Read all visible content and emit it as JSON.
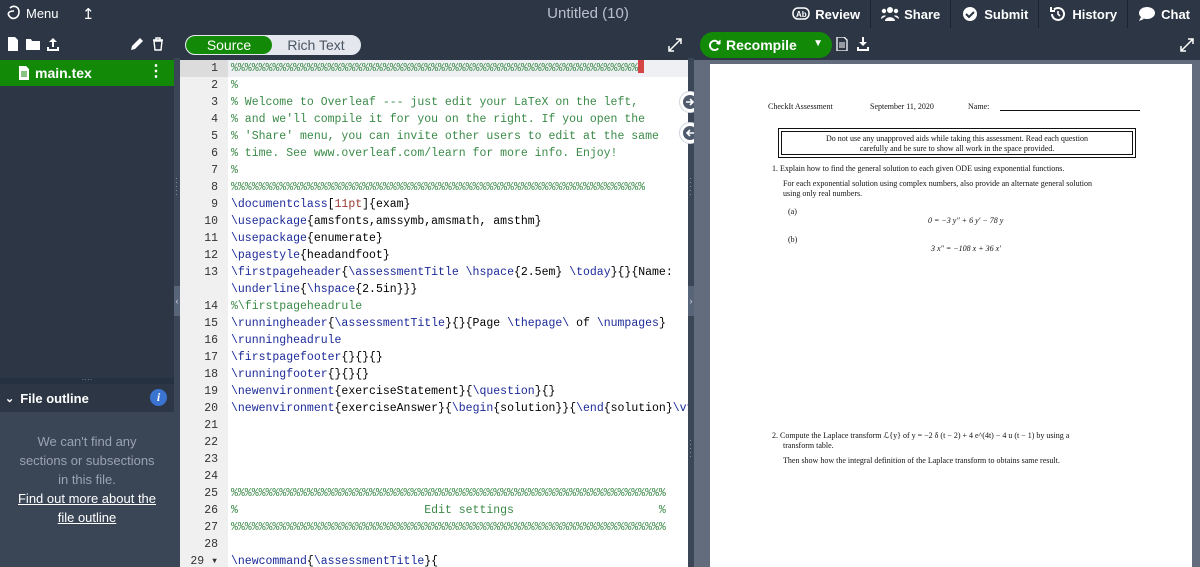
{
  "topbar": {
    "menu_label": "Menu",
    "title": "Untitled (10)",
    "buttons": [
      {
        "label": "Review",
        "icon": "review-icon"
      },
      {
        "label": "Share",
        "icon": "share-icon"
      },
      {
        "label": "Submit",
        "icon": "submit-icon"
      },
      {
        "label": "History",
        "icon": "history-icon"
      },
      {
        "label": "Chat",
        "icon": "chat-icon"
      }
    ]
  },
  "sidebar": {
    "file_name": "main.tex",
    "outline_title": "File outline",
    "outline_empty": [
      "We can't find any",
      "sections or subsections",
      "in this file."
    ],
    "outline_link": [
      "Find out more about the",
      "file outline"
    ]
  },
  "editor": {
    "toggle_source": "Source",
    "toggle_rich": "Rich Text"
  },
  "preview": {
    "recompile_label": "Recompile",
    "pdf": {
      "hdr_left": "CheckIt Assessment",
      "hdr_date": "September 11, 2020",
      "hdr_name": "Name:",
      "notice_1": "Do not use any unapproved aids while taking this assessment. Read each question",
      "notice_2": "carefully and be sure to show all work in the space provided.",
      "q1_title": "1.  Explain how to find the general solution to each given ODE using exponential functions.",
      "q1_sub_1": "For each exponential solution using complex numbers, also provide an alternate general solution",
      "q1_sub_2": "using only real numbers.",
      "q1_a": "(a)",
      "q1_a_eq": "0 = −3 y″ + 6 y′ − 78 y",
      "q1_b": "(b)",
      "q1_b_eq": "3 x″ = −108 x + 36 x′",
      "q2_title": "2.  Compute the Laplace transform ℒ{y} of y = −2 δ (t − 2) + 4 e^(4t) − 4 u (t − 1) by using a",
      "q2_title_2": "transform table.",
      "q2_sub": "Then show how the integral definition of the Laplace transform to obtains same result."
    }
  },
  "lines": [
    {
      "n": "1",
      "t": "%%%%%%%%%%%%%%%%%%%%%%%%%%%%%%%%%%%%%%%%%%%%%%%%%%%%%%%%%%%"
    },
    {
      "n": "2",
      "t": "%"
    },
    {
      "n": "3",
      "t": "% Welcome to Overleaf --- just edit your LaTeX on the left,"
    },
    {
      "n": "4",
      "t": "% and we'll compile it for you on the right. If you open the"
    },
    {
      "n": "5",
      "t": "% 'Share' menu, you can invite other users to edit at the same"
    },
    {
      "n": "6",
      "t": "% time. See www.overleaf.com/learn for more info. Enjoy!"
    },
    {
      "n": "7",
      "t": "%"
    },
    {
      "n": "8",
      "t": "%%%%%%%%%%%%%%%%%%%%%%%%%%%%%%%%%%%%%%%%%%%%%%%%%%%%%%%%%%%%"
    },
    {
      "n": "9",
      "t": "\\documentclass[11pt]{exam}"
    },
    {
      "n": "10",
      "t": "\\usepackage{amsfonts,amssymb,amsmath, amsthm}"
    },
    {
      "n": "11",
      "t": "\\usepackage{enumerate}"
    },
    {
      "n": "12",
      "t": "\\pagestyle{headandfoot}"
    },
    {
      "n": "13",
      "t": "\\firstpageheader{\\assessmentTitle \\hspace{2.5em} \\today}{}{Name:"
    },
    {
      "n": "",
      "t": "\\underline{\\hspace{2.5in}}}"
    },
    {
      "n": "14",
      "t": "%\\firstpageheadrule"
    },
    {
      "n": "15",
      "t": "\\runningheader{\\assessmentTitle}{}{Page \\thepage\\ of \\numpages}"
    },
    {
      "n": "16",
      "t": "\\runningheadrule"
    },
    {
      "n": "17",
      "t": "\\firstpagefooter{}{}{}"
    },
    {
      "n": "18",
      "t": "\\runningfooter{}{}{}"
    },
    {
      "n": "19",
      "t": "\\newenvironment{exerciseStatement}{\\question}{}"
    },
    {
      "n": "20",
      "t": "\\newenvironment{exerciseAnswer}{\\begin{solution}}{\\end{solution}\\vfill}"
    },
    {
      "n": "21",
      "t": ""
    },
    {
      "n": "22",
      "t": ""
    },
    {
      "n": "23",
      "t": ""
    },
    {
      "n": "24",
      "t": ""
    },
    {
      "n": "25",
      "t": "%%%%%%%%%%%%%%%%%%%%%%%%%%%%%%%%%%%%%%%%%%%%%%%%%%%%%%%%%%%%%%%"
    },
    {
      "n": "26",
      "t": "%                           Edit settings                     %"
    },
    {
      "n": "27",
      "t": "%%%%%%%%%%%%%%%%%%%%%%%%%%%%%%%%%%%%%%%%%%%%%%%%%%%%%%%%%%%%%%%"
    },
    {
      "n": "28",
      "t": ""
    },
    {
      "n": "29 ▾",
      "t": "\\newcommand{\\assessmentTitle}{"
    }
  ]
}
